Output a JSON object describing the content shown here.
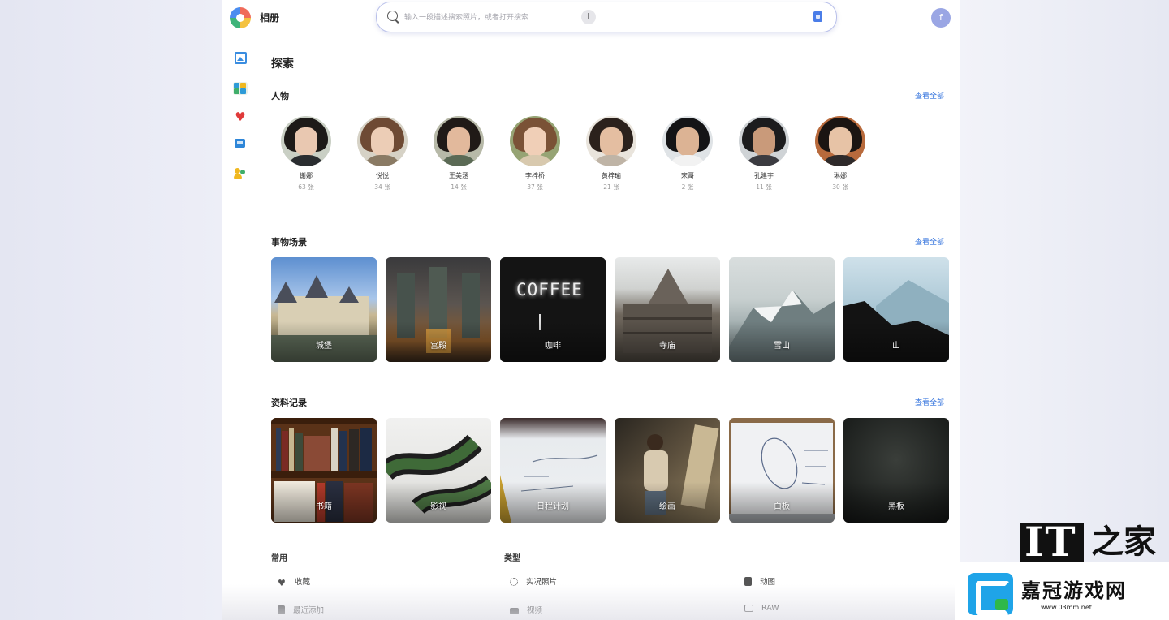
{
  "app": {
    "title": "相册",
    "avatar_letter": "f"
  },
  "search": {
    "placeholder": "输入一段描述搜索照片，或者打开搜索",
    "cursor_glyph": "I"
  },
  "page": {
    "title": "探索"
  },
  "people": {
    "title": "人物",
    "see_all": "查看全部",
    "items": [
      {
        "name": "谢娜",
        "count": "63 张"
      },
      {
        "name": "悦悦",
        "count": "34 张"
      },
      {
        "name": "王美涵",
        "count": "14 张"
      },
      {
        "name": "李梓桥",
        "count": "37 张"
      },
      {
        "name": "黄梓瑜",
        "count": "21 张"
      },
      {
        "name": "宋哥",
        "count": "2 张"
      },
      {
        "name": "孔建宇",
        "count": "11 张"
      },
      {
        "name": "琳娜",
        "count": "30 张"
      }
    ]
  },
  "scenes": {
    "title": "事物场景",
    "see_all": "查看全部",
    "items": [
      {
        "label": "城堡"
      },
      {
        "label": "宫殿"
      },
      {
        "label": "咖啡"
      },
      {
        "label": "寺庙"
      },
      {
        "label": "雪山"
      },
      {
        "label": "山"
      }
    ],
    "coffee_sign": "COFFEE"
  },
  "records": {
    "title": "资料记录",
    "see_all": "查看全部",
    "items": [
      {
        "label": "书籍"
      },
      {
        "label": "影视"
      },
      {
        "label": "日程计划"
      },
      {
        "label": "绘画"
      },
      {
        "label": "白板"
      },
      {
        "label": "黑板"
      }
    ]
  },
  "common": {
    "title": "常用",
    "items": [
      {
        "label": "收藏",
        "icon": "heart-icon"
      },
      {
        "label": "最近添加",
        "icon": "recent-icon"
      }
    ]
  },
  "types": {
    "title": "类型",
    "items": [
      {
        "label": "实况照片",
        "icon": "live-photo-icon"
      },
      {
        "label": "动图",
        "icon": "gif-icon"
      },
      {
        "label": "视频",
        "icon": "video-icon"
      },
      {
        "label": "RAW",
        "icon": "camera-icon"
      }
    ]
  },
  "watermark": {
    "it": "IT",
    "zhi": "之家",
    "brand": "嘉冠游戏网",
    "url": "www.03mm.net"
  },
  "colors": {
    "accent": "#2e6fdc",
    "favorite": "#e03a3a"
  }
}
